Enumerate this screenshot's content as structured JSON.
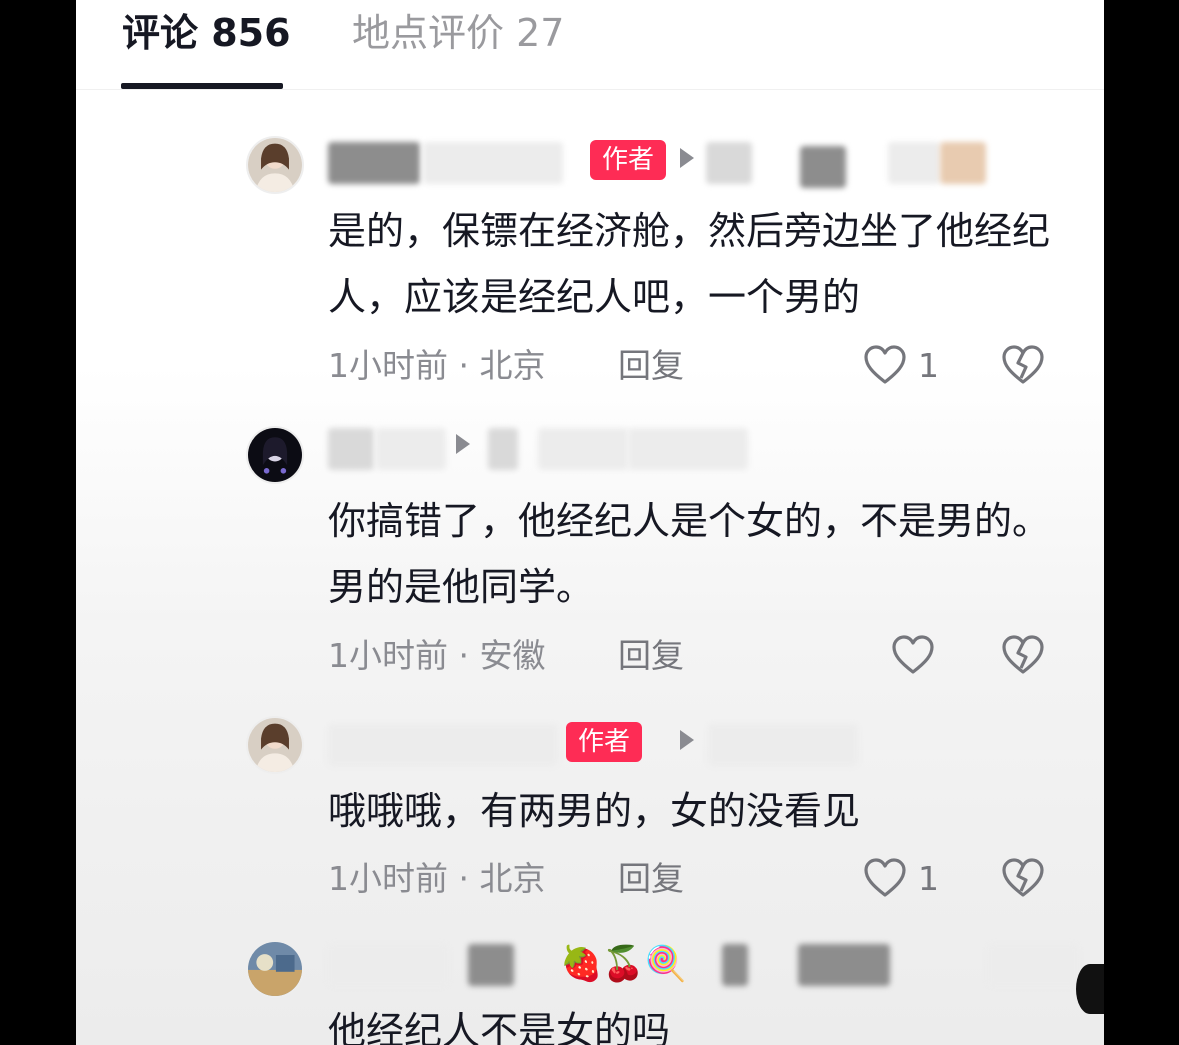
{
  "tabs": {
    "comments": "评论 856",
    "location_reviews": "地点评价 27"
  },
  "comments": [
    {
      "author_badge": "作者",
      "text": "是的，保镖在经济舱，然后旁边坐了他经纪人，应该是经纪人吧，一个男的",
      "time_location": "1小时前 · 北京",
      "reply_label": "回复",
      "like_count": "1"
    },
    {
      "text": "你搞错了，他经纪人是个女的，不是男的。男的是他同学。",
      "time_location": "1小时前 · 安徽",
      "reply_label": "回复",
      "like_count": ""
    },
    {
      "author_badge": "作者",
      "text": "哦哦哦，有两男的，女的没看见",
      "time_location": "1小时前 · 北京",
      "reply_label": "回复",
      "like_count": "1"
    },
    {
      "name_emojis": "🍓🍒🍭",
      "text": "他经纪人不是女的吗"
    }
  ],
  "icons": {
    "like": "heart-outline-icon",
    "dislike": "broken-heart-icon",
    "reply_to": "play-triangle-icon"
  },
  "colors": {
    "accent": "#fe2c55",
    "text_primary": "#161823",
    "text_secondary": "#8a8b91"
  }
}
